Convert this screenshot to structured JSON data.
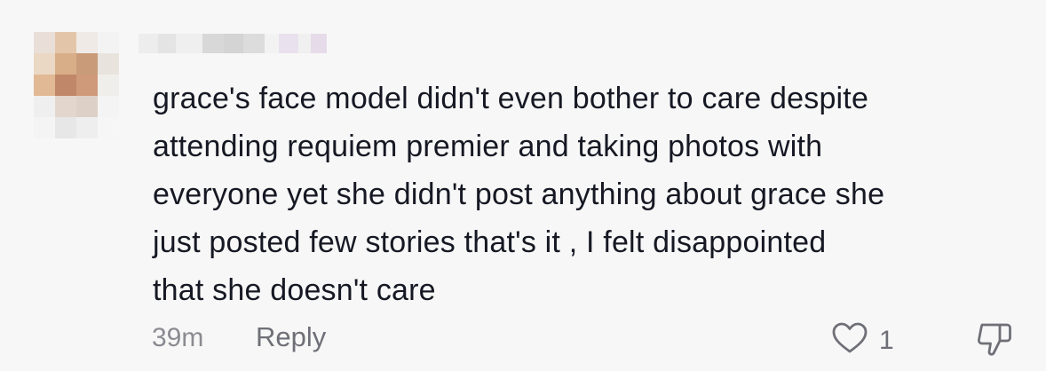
{
  "comment": {
    "text": "grace's face model didn't even bother to care despite\nattending requiem premier and taking photos with\neveryone yet she didn't post anything about grace she\njust posted few stories that's it , I felt disappointed\nthat she doesn't care",
    "timestamp": "39m",
    "reply_label": "Reply",
    "like_count": "1",
    "avatar_censored": true,
    "username_censored": true
  },
  "icons": {
    "like": "heart-outline-icon",
    "dislike": "thumbs-down-icon"
  },
  "colors": {
    "background": "#f7f7f7",
    "text": "#161823",
    "muted": "#8a8b91"
  }
}
